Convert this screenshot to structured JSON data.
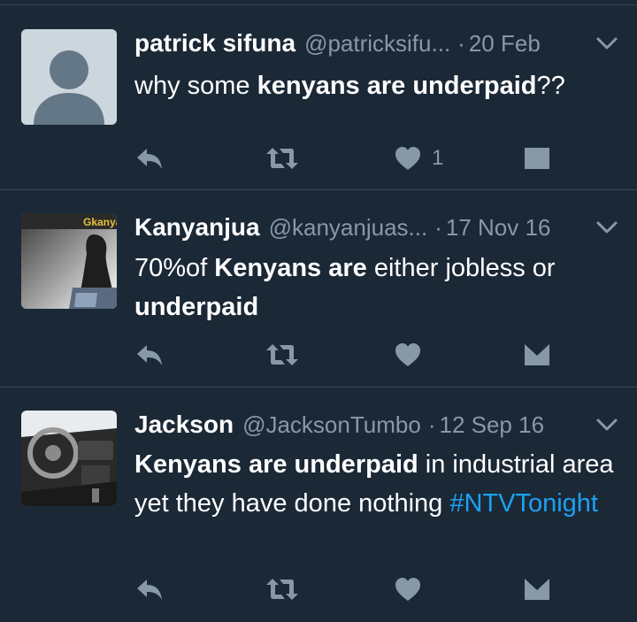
{
  "tweets": [
    {
      "name": "patrick sifuna",
      "handle": "@patricksifu...",
      "dot": "·",
      "time": "20 Feb",
      "segments": [
        {
          "text": "why some ",
          "bold": false
        },
        {
          "text": "kenyans are underpaid",
          "bold": true
        },
        {
          "text": "??",
          "bold": false
        }
      ],
      "likes": "1",
      "avatar": "default-profile"
    },
    {
      "name": "Kanyanjua",
      "handle": "@kanyanjuas...",
      "dot": "·",
      "time": "17 Nov 16",
      "segments": [
        {
          "text": "70%of ",
          "bold": false
        },
        {
          "text": "Kenyans are",
          "bold": true
        },
        {
          "text": " either jobless or ",
          "bold": false
        },
        {
          "text": "underpaid",
          "bold": true
        }
      ],
      "likes": "",
      "avatar": "photo",
      "avatar_text": "Gkanya"
    },
    {
      "name": "Jackson",
      "handle": "@JacksonTumbo",
      "dot": "·",
      "time": "12 Sep 16",
      "segments": [
        {
          "text": "Kenyans are underpaid",
          "bold": true
        },
        {
          "text": " in industrial area yet they have done nothing ",
          "bold": false
        }
      ],
      "hashtag": "#NTVTonight",
      "likes": "",
      "avatar": "car-interior"
    }
  ],
  "colors": {
    "background": "#1b2836",
    "muted": "#8899a6",
    "link": "#1da1f2",
    "divider": "#3a4756"
  },
  "icons": [
    "reply-icon",
    "retweet-icon",
    "like-icon",
    "message-icon",
    "chevron-down-icon"
  ]
}
